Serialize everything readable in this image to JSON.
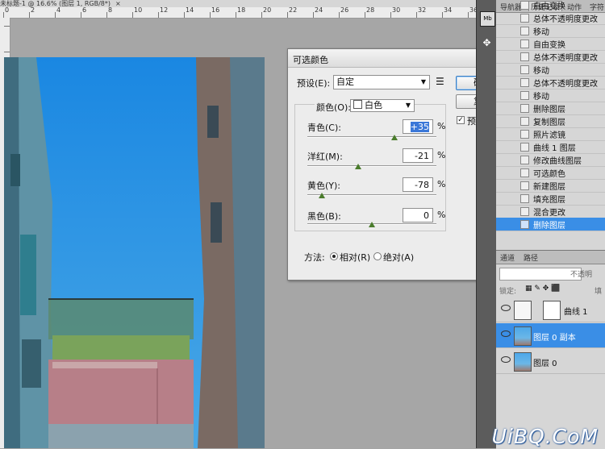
{
  "document": {
    "tab_title": "未标题-1 @ 16.6% (图层 1, RGB/8*)",
    "tab_close": "×",
    "ruler_numbers": [
      "0",
      "2",
      "4",
      "6",
      "8",
      "10",
      "12",
      "14",
      "16",
      "18",
      "20",
      "22",
      "24",
      "26",
      "28",
      "30",
      "32",
      "34",
      "36"
    ]
  },
  "dialog": {
    "title": "可选颜色",
    "preset_label": "预设(E):",
    "preset_value": "自定",
    "ok_label": "确定",
    "reset_label": "复位",
    "preview_label": "预览(P)",
    "preview_checked": true,
    "colors_label": "颜色(O):",
    "colors_value": "白色",
    "sliders": [
      {
        "label": "青色(C):",
        "value": "+35",
        "level": 35
      },
      {
        "label": "洋红(M):",
        "value": "-21",
        "level": -21
      },
      {
        "label": "黄色(Y):",
        "value": "-78",
        "level": -78
      },
      {
        "label": "黑色(B):",
        "value": "0",
        "level": 0
      }
    ],
    "percent": "%",
    "method_label": "方法:",
    "method_relative": "相对(R)",
    "method_absolute": "绝对(A)",
    "method_selected": "relative"
  },
  "history": {
    "tabs": [
      "导航器",
      "历史记录",
      "动作",
      "字符"
    ],
    "active_tab": "历史记录",
    "items": [
      "自由变换",
      "总体不透明度更改",
      "移动",
      "自由变换",
      "总体不透明度更改",
      "移动",
      "总体不透明度更改",
      "移动",
      "删除图层",
      "复制图层",
      "照片滤镜",
      "曲线 1 图层",
      "修改曲线图层",
      "可选颜色",
      "新建图层",
      "填充图层",
      "混合更改",
      "删除图层"
    ],
    "selected_index": 17
  },
  "layers": {
    "tabs": [
      "通道",
      "路径"
    ],
    "opacity_label": "不透明",
    "lock_label": "锁定:",
    "fill_label": "填",
    "items": [
      {
        "name": "曲线 1",
        "selected": false
      },
      {
        "name": "图层 0 副本",
        "selected": true
      },
      {
        "name": "图层 0",
        "selected": false
      }
    ]
  },
  "watermark": "UiBQ.CoM",
  "colors": {
    "accent": "#3a8ee6",
    "sky": "#1f8ee6",
    "close": "#c73a2a"
  }
}
